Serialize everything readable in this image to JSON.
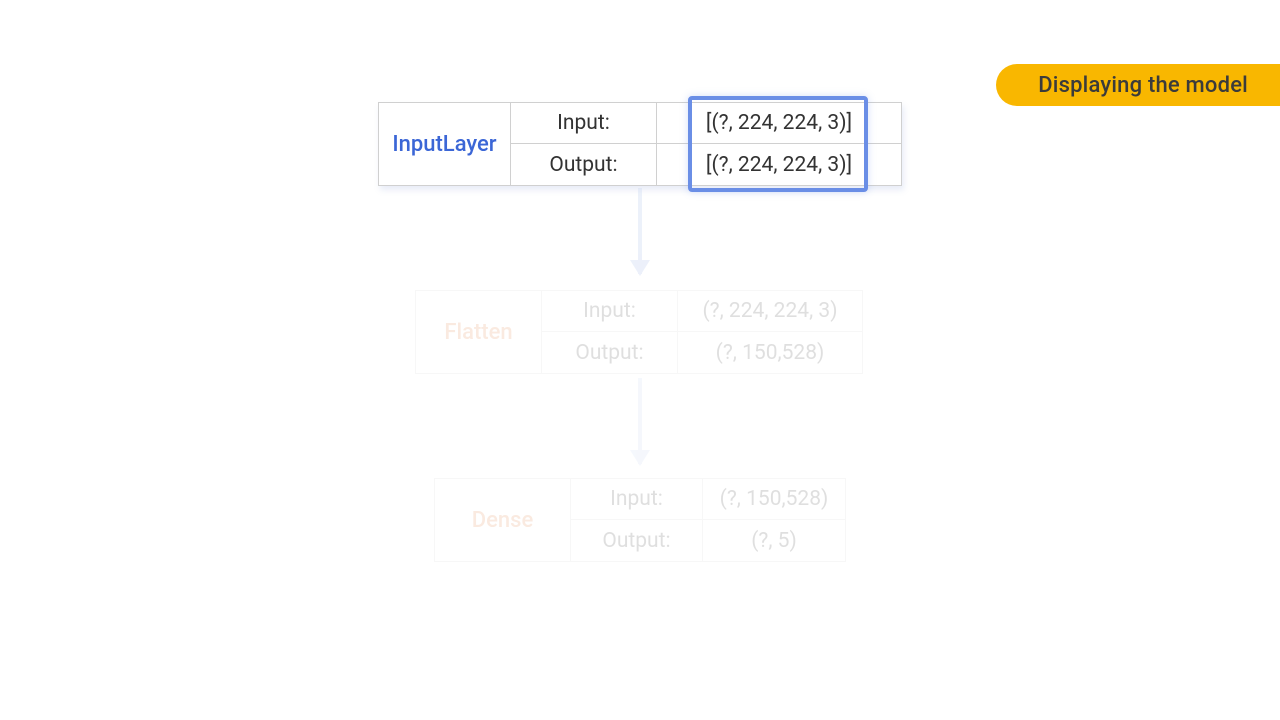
{
  "pill_label": "Displaying the model",
  "layers": [
    {
      "name": "InputLayer",
      "input_label": "Input:",
      "output_label": "Output:",
      "input_value": "[(?, 224, 224, 3)]",
      "output_value": "[(?, 224, 224, 3)]"
    },
    {
      "name": "Flatten",
      "input_label": "Input:",
      "output_label": "Output:",
      "input_value": "(?, 224, 224, 3)",
      "output_value": "(?, 150,528)"
    },
    {
      "name": "Dense",
      "input_label": "Input:",
      "output_label": "Output:",
      "input_value": "(?, 150,528)",
      "output_value": "(?, 5)"
    }
  ]
}
